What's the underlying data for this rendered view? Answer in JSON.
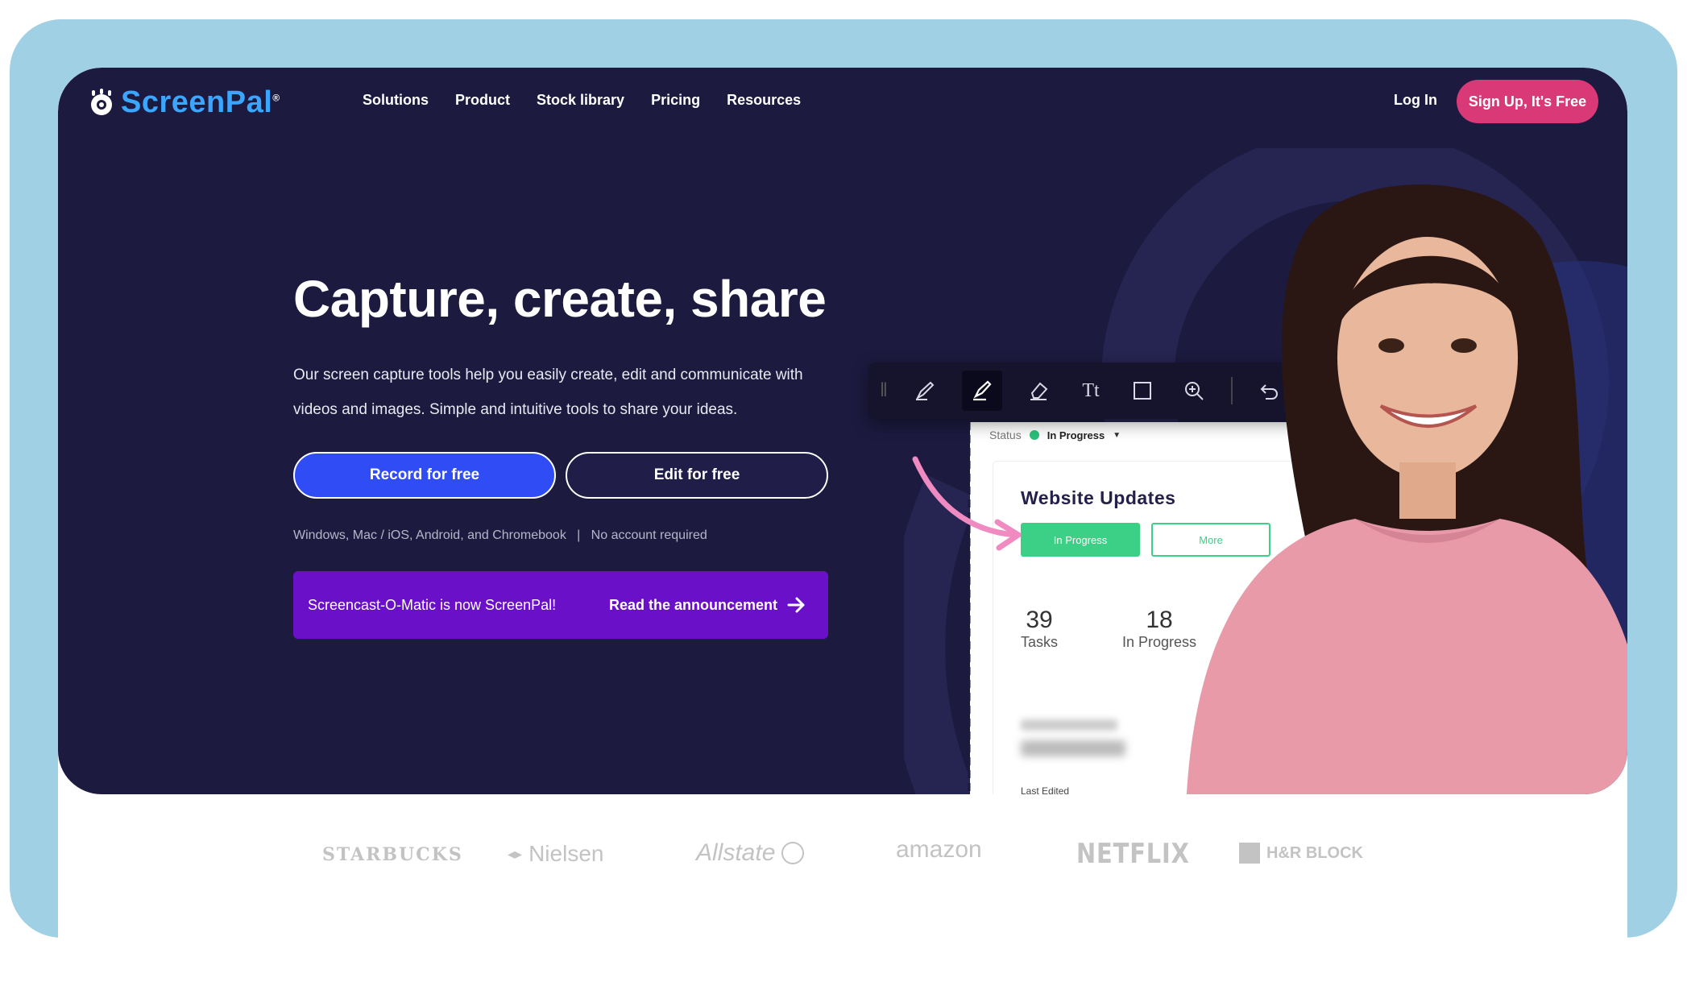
{
  "brand": {
    "name": "ScreenPal",
    "registered": "®"
  },
  "nav": {
    "items": [
      "Solutions",
      "Product",
      "Stock library",
      "Pricing",
      "Resources"
    ],
    "login": "Log In",
    "signup": "Sign Up, It's Free"
  },
  "hero": {
    "title": "Capture, create, share",
    "subtitle": "Our screen capture tools help you easily create, edit and communicate with videos and images. Simple and intuitive tools to share your ideas.",
    "record_btn": "Record for free",
    "edit_btn": "Edit for free",
    "platforms": "Windows, Mac / iOS, Android, and Chromebook",
    "no_account": "No account required"
  },
  "announcement": {
    "text": "Screencast-O-Matic is now ScreenPal!",
    "link": "Read the announcement"
  },
  "mockup": {
    "toolbar_icons": [
      "pen-icon",
      "highlighter-icon",
      "eraser-icon",
      "text-icon",
      "rectangle-icon",
      "zoom-icon",
      "undo-icon",
      "redo-icon"
    ],
    "status_label": "Status",
    "status_value": "In Progress",
    "card_title": "Website Updates",
    "pill_primary": "In Progress",
    "pill_secondary": "More",
    "stats": [
      {
        "value": "39",
        "label": "Tasks"
      },
      {
        "value": "18",
        "label": "In Progress"
      }
    ],
    "last_edited": "Last Edited"
  },
  "partners": [
    "STARBUCKS",
    "Nielsen",
    "Allstate",
    "amazon",
    "NETFLIX",
    "H&R BLOCK"
  ],
  "colors": {
    "hero_bg": "#1c1a3e",
    "accent_blue": "#2f4cf5",
    "signup_pink": "#d93a77",
    "announce_purple": "#6b10c9",
    "status_green": "#3ccf86",
    "frame_blue": "#9fd0e3"
  }
}
